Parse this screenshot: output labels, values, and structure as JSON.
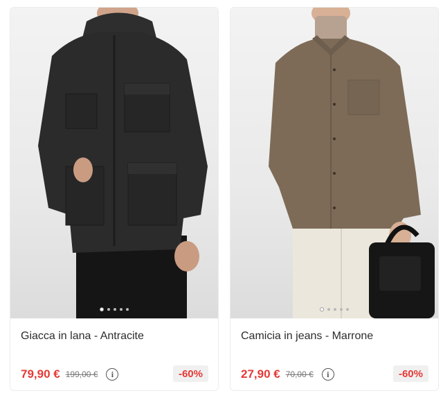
{
  "products": [
    {
      "name": "Giacca in lana - Antracite",
      "price": "79,90 €",
      "old_price": "199,00 €",
      "discount": "-60%",
      "image": "man-wearing-charcoal-wool-field-jacket",
      "carousel_dots": 5,
      "active_dot": 1,
      "colors": {
        "garment": "#2b2b2b",
        "accent": "#e53935"
      }
    },
    {
      "name": "Camicia in jeans - Marrone",
      "price": "27,90 €",
      "old_price": "70,00 €",
      "discount": "-60%",
      "image": "man-wearing-brown-shirt-with-black-bag",
      "carousel_dots": 5,
      "active_dot": 1,
      "colors": {
        "garment": "#7d6b58",
        "accent": "#e53935"
      }
    }
  ],
  "icons": {
    "info": "info-icon"
  }
}
